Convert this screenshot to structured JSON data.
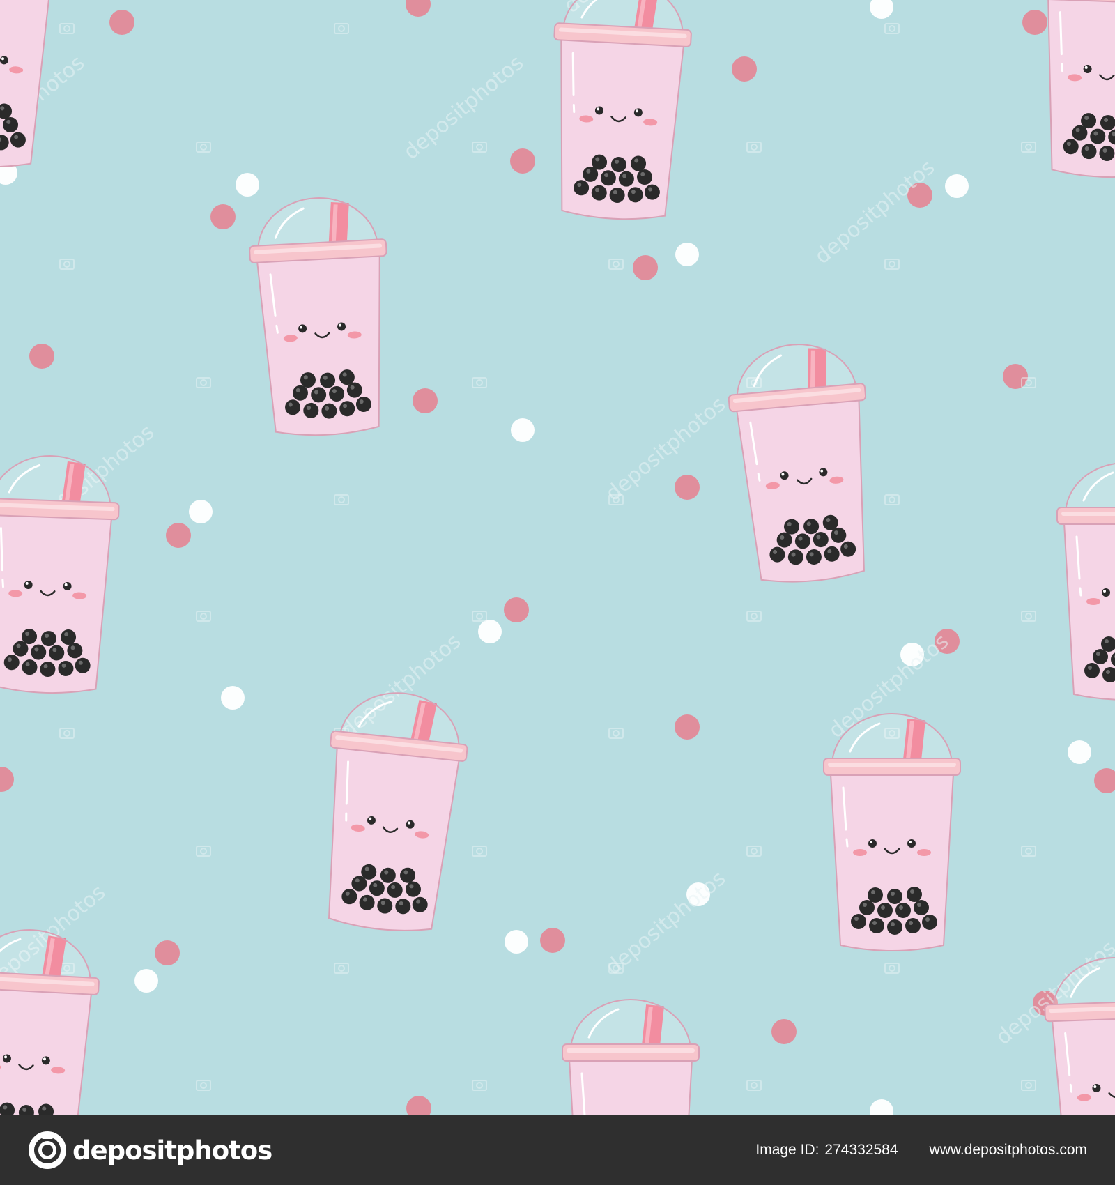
{
  "colors": {
    "background": "#b8dde1",
    "cup_body": "#f5d5e6",
    "cup_lid": "#f7c5cc",
    "cup_outline": "#d9a1b6",
    "straw": "#f0758b",
    "pearl": "#2a2a2a",
    "blush": "#f28d9c",
    "dot_pink": "#e48595",
    "dot_white": "#ffffff",
    "watermark": "#e9f4f5",
    "footer_bg": "#2f2f2f",
    "footer_text": "#ffffff"
  },
  "watermark_text": "depositphotos",
  "footer": {
    "brand": "depositphotos",
    "image_id_label": "Image ID:",
    "image_id": "274332584",
    "site": "www.depositphotos.com"
  },
  "icons": {
    "brand_logo": "camera-shutter-icon",
    "watermark_small": "camera-icon"
  }
}
